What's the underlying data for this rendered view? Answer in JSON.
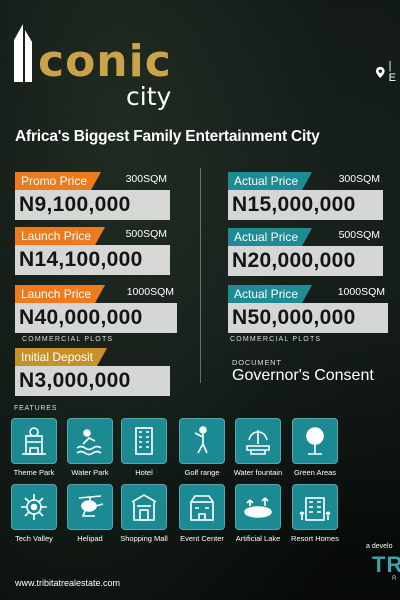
{
  "brand": {
    "logo_main": "conic",
    "logo_sub": "city",
    "location_text": "| E"
  },
  "tagline": "Africa's Biggest Family Entertainment City",
  "left_prices": [
    {
      "label": "Promo Price",
      "size": "300SQM",
      "value": "N9,100,000",
      "style": "orange"
    },
    {
      "label": "Launch Price",
      "size": "500SQM",
      "value": "N14,100,000",
      "style": "orange"
    },
    {
      "label": "Launch Price",
      "size": "1000SQM",
      "value": "N40,000,000",
      "style": "orange"
    }
  ],
  "right_prices": [
    {
      "label": "Actual Price",
      "size": "300SQM",
      "value": "N15,000,000",
      "style": "teal"
    },
    {
      "label": "Actual Price",
      "size": "500SQM",
      "value": "N20,000,000",
      "style": "teal"
    },
    {
      "label": "Actual Price",
      "size": "1000SQM",
      "value": "N50,000,000",
      "style": "teal"
    }
  ],
  "commercial_left": "COMMERCIAL PLOTS",
  "commercial_right": "COMMERCIAL PLOTS",
  "deposit": {
    "label": "Initial Deposit",
    "value": "N3,000,000"
  },
  "document": {
    "label": "DOCUMENT",
    "value": "Governor's Consent"
  },
  "features_label": "FEATURES",
  "features": [
    {
      "name": "Theme Park",
      "icon": "theme-park-icon"
    },
    {
      "name": "Water Park",
      "icon": "water-park-icon"
    },
    {
      "name": "Hotel",
      "icon": "hotel-icon"
    },
    {
      "name": "Golf range",
      "icon": "golf-icon"
    },
    {
      "name": "Water fountain",
      "icon": "fountain-icon"
    },
    {
      "name": "Green Areas",
      "icon": "tree-icon"
    },
    {
      "name": "Tech Valley",
      "icon": "tech-icon"
    },
    {
      "name": "Helipad",
      "icon": "helipad-icon"
    },
    {
      "name": "Shopping Mall",
      "icon": "mall-icon"
    },
    {
      "name": "Event Center",
      "icon": "event-icon"
    },
    {
      "name": "Artificial Lake",
      "icon": "lake-icon"
    },
    {
      "name": "Resort Homes",
      "icon": "resort-icon"
    }
  ],
  "website": "www.tribitatrealestate.com",
  "developer_text": "a develo",
  "developer_brand": "TRI",
  "developer_brand_sub": "R",
  "colors": {
    "orange": "#ee7a1f",
    "teal": "#1f8b95",
    "gold": "#c7902a",
    "logo_gold": "#c9a24a"
  }
}
